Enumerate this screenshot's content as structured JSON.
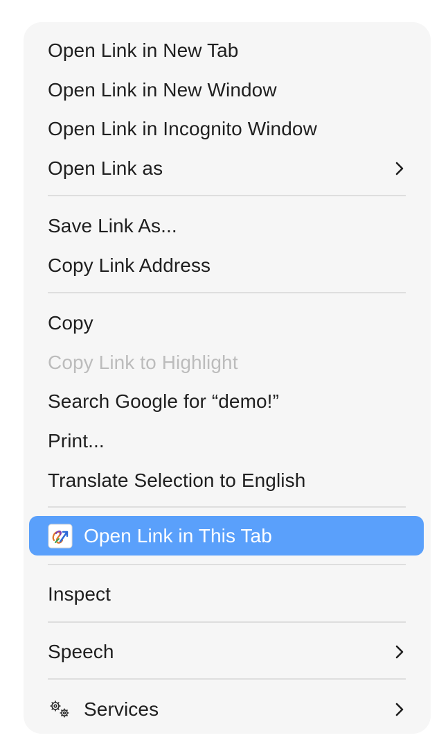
{
  "menu": {
    "items": [
      {
        "label": "Open Link in New Tab"
      },
      {
        "label": "Open Link in New Window"
      },
      {
        "label": "Open Link in Incognito Window"
      },
      {
        "label": "Open Link as",
        "submenu": true
      },
      {
        "label": "Save Link As..."
      },
      {
        "label": "Copy Link Address"
      },
      {
        "label": "Copy"
      },
      {
        "label": "Copy Link to Highlight",
        "disabled": true
      },
      {
        "label": "Search Google for “demo!”"
      },
      {
        "label": "Print..."
      },
      {
        "label": "Translate Selection to English"
      },
      {
        "label": "Open Link in This Tab",
        "icon": "link-extension-icon",
        "highlighted": true
      },
      {
        "label": "Inspect"
      },
      {
        "label": "Speech",
        "submenu": true
      },
      {
        "label": "Services",
        "icon": "gears-icon",
        "submenu": true
      }
    ]
  },
  "colors": {
    "menu_background": "#f6f6f6",
    "highlight": "#5aa0fb",
    "disabled_text": "#bcbcbc",
    "separator": "#dedede"
  }
}
